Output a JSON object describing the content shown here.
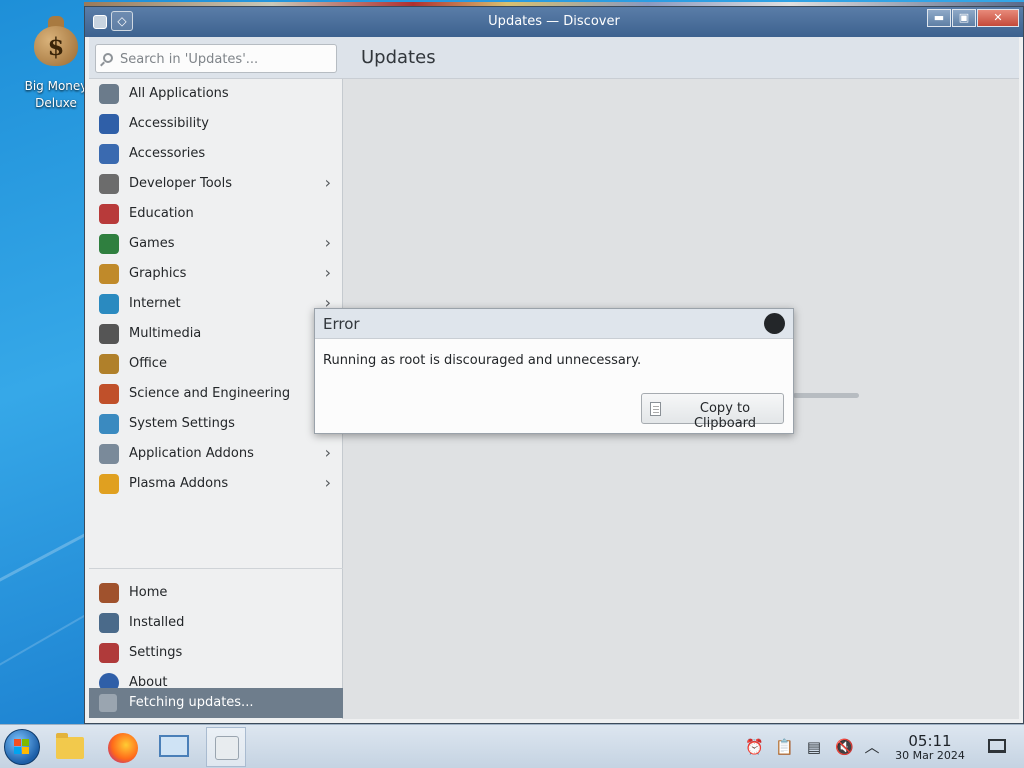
{
  "desktop": {
    "icon_label_line1": "Big Money",
    "icon_label_line2": "Deluxe"
  },
  "window": {
    "title": "Updates — Discover",
    "buttons": [
      "minimize",
      "maximize",
      "close"
    ]
  },
  "search": {
    "placeholder": "Search in 'Updates'..."
  },
  "page_title": "Updates",
  "sidebar": {
    "categories": [
      {
        "label": "All Applications",
        "icon": "all-apps-icon",
        "has_submenu": false
      },
      {
        "label": "Accessibility",
        "icon": "accessibility-icon",
        "has_submenu": false
      },
      {
        "label": "Accessories",
        "icon": "accessories-icon",
        "has_submenu": false
      },
      {
        "label": "Developer Tools",
        "icon": "developer-tools-icon",
        "has_submenu": true
      },
      {
        "label": "Education",
        "icon": "education-icon",
        "has_submenu": false
      },
      {
        "label": "Games",
        "icon": "games-icon",
        "has_submenu": true
      },
      {
        "label": "Graphics",
        "icon": "graphics-icon",
        "has_submenu": true
      },
      {
        "label": "Internet",
        "icon": "internet-icon",
        "has_submenu": true
      },
      {
        "label": "Multimedia",
        "icon": "multimedia-icon",
        "has_submenu": false
      },
      {
        "label": "Office",
        "icon": "office-icon",
        "has_submenu": false
      },
      {
        "label": "Science and Engineering",
        "icon": "science-icon",
        "has_submenu": false
      },
      {
        "label": "System Settings",
        "icon": "system-settings-icon",
        "has_submenu": false
      },
      {
        "label": "Application Addons",
        "icon": "application-addons-icon",
        "has_submenu": true
      },
      {
        "label": "Plasma Addons",
        "icon": "plasma-addons-icon",
        "has_submenu": true
      }
    ],
    "footer": [
      {
        "label": "Home",
        "icon": "home-icon"
      },
      {
        "label": "Installed",
        "icon": "installed-icon"
      },
      {
        "label": "Settings",
        "icon": "settings-icon"
      },
      {
        "label": "About",
        "icon": "about-icon"
      }
    ],
    "status": "Fetching updates..."
  },
  "dialog": {
    "title": "Error",
    "message": "Running as root is discouraged and unnecessary.",
    "button_label": "Copy to Clipboard"
  },
  "taskbar": {
    "apps": [
      "start-menu",
      "file-manager",
      "firefox",
      "system-settings",
      "discover"
    ],
    "tray": [
      "notifications-icon",
      "clipboard-icon",
      "updates-icon",
      "volume-muted-icon",
      "expand-tray-icon"
    ],
    "time": "05:11",
    "date": "30 Mar 2024"
  },
  "colors": {
    "titlebar": "#3d628f",
    "status_bar": "#6e7d8c",
    "desktop": "#1e8fd8"
  }
}
